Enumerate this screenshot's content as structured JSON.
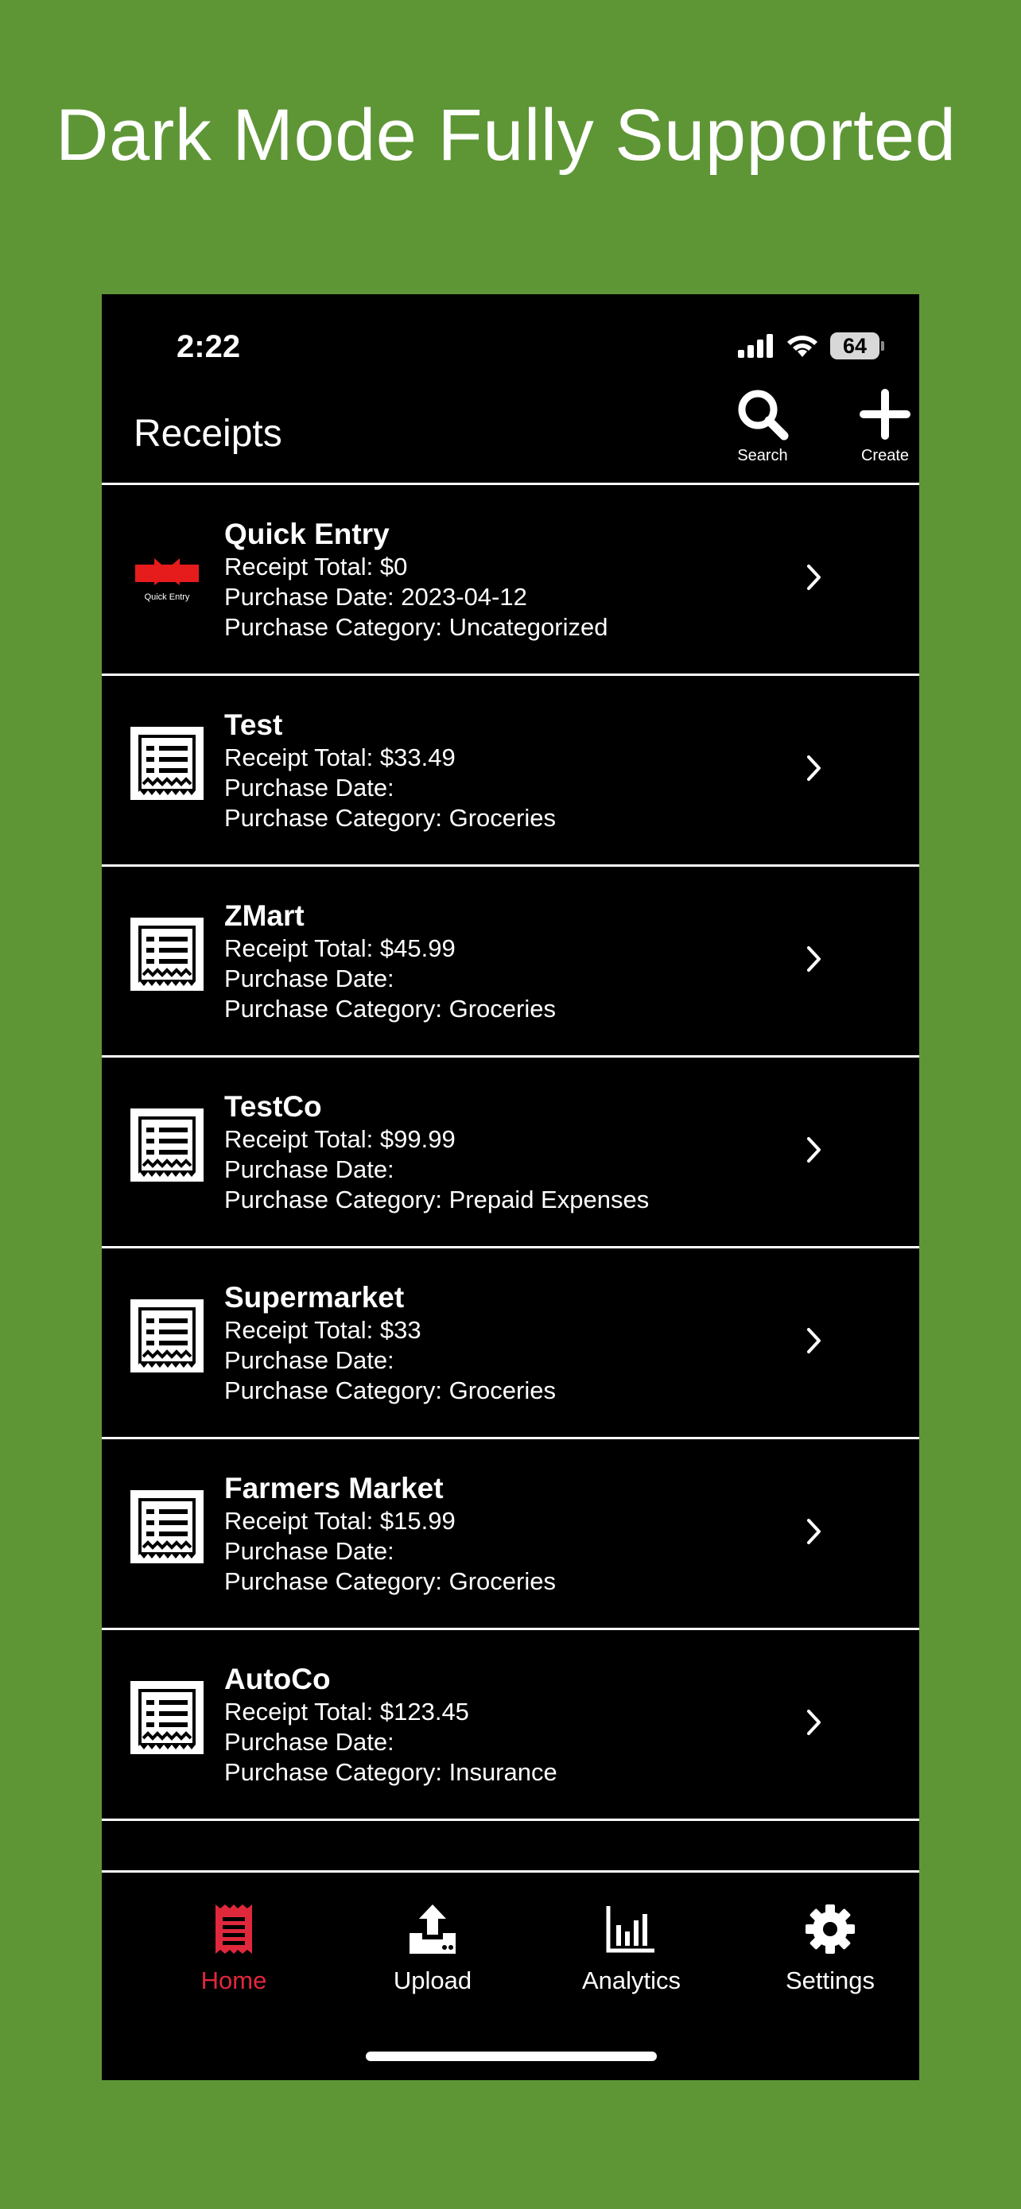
{
  "headline": "Dark Mode Fully Supported",
  "status_bar": {
    "time": "2:22",
    "battery": "64"
  },
  "nav": {
    "title": "Receipts",
    "search_label": "Search",
    "create_label": "Create"
  },
  "receipts": [
    {
      "title": "Quick Entry",
      "total": "Receipt Total: $0",
      "date": "Purchase Date: 2023-04-12",
      "category": "Purchase Category: Uncategorized",
      "logo_text": "Quick Entry"
    },
    {
      "title": "Test",
      "total": "Receipt Total: $33.49",
      "date": "Purchase Date:",
      "category": "Purchase Category: Groceries"
    },
    {
      "title": "ZMart",
      "total": "Receipt Total: $45.99",
      "date": "Purchase Date:",
      "category": "Purchase Category: Groceries"
    },
    {
      "title": "TestCo",
      "total": "Receipt Total: $99.99",
      "date": "Purchase Date:",
      "category": "Purchase Category: Prepaid Expenses"
    },
    {
      "title": "Supermarket",
      "total": "Receipt Total: $33",
      "date": "Purchase Date:",
      "category": "Purchase Category: Groceries"
    },
    {
      "title": "Farmers Market",
      "total": "Receipt Total: $15.99",
      "date": "Purchase Date:",
      "category": "Purchase Category: Groceries"
    },
    {
      "title": "AutoCo",
      "total": "Receipt Total: $123.45",
      "date": "Purchase Date:",
      "category": "Purchase Category: Insurance"
    }
  ],
  "tabs": [
    {
      "label": "Home",
      "icon": "receipt-icon",
      "active": true
    },
    {
      "label": "Upload",
      "icon": "upload-icon",
      "active": false
    },
    {
      "label": "Analytics",
      "icon": "bar-chart-icon",
      "active": false
    },
    {
      "label": "Settings",
      "icon": "gear-icon",
      "active": false
    }
  ],
  "colors": {
    "background": "#5e9636",
    "screen": "#000000",
    "accent": "#e0283c",
    "text": "#ffffff"
  }
}
